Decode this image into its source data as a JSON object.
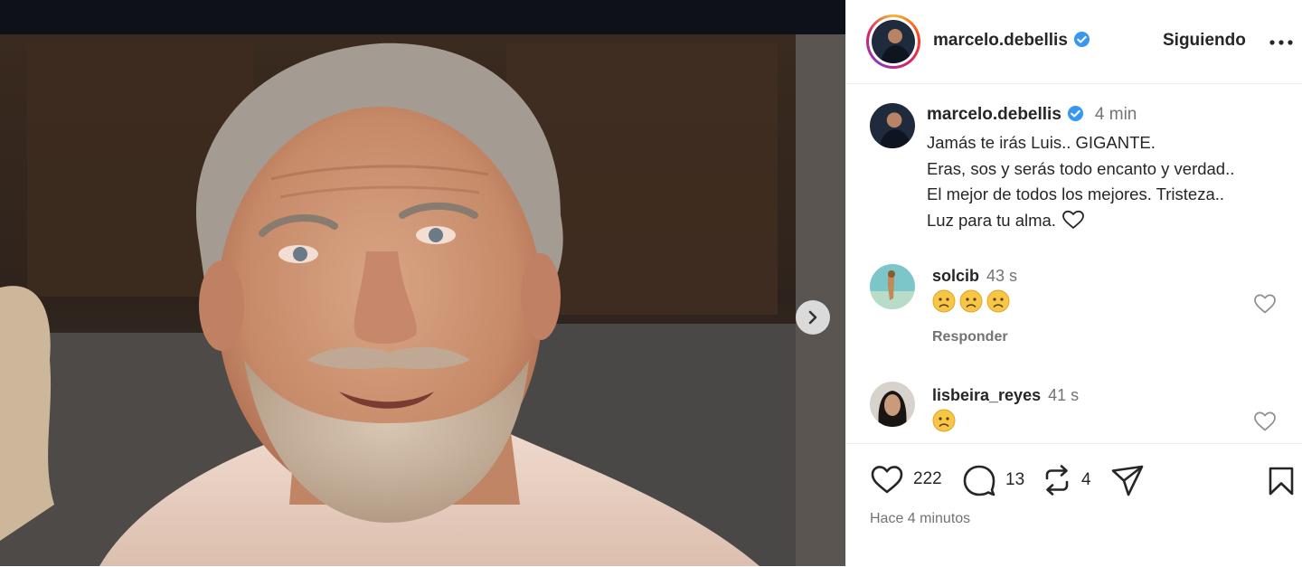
{
  "post": {
    "username": "marcelo.debellis",
    "verified": true,
    "follow_state": "Siguiendo",
    "more_icon": "more-horizontal-icon",
    "next_icon": "chevron-right-icon"
  },
  "caption": {
    "username": "marcelo.debellis",
    "time": "4 min",
    "lines": [
      "Jamás te irás Luis.. GIGANTE.",
      "Eras, sos y serás todo encanto y verdad..",
      "El mejor de todos los mejores. Tristeza..",
      "Luz para tu alma."
    ],
    "trailing_icon": "heart-outline-icon"
  },
  "comments": [
    {
      "username": "solcib",
      "time": "43 s",
      "emoji": "sad-face",
      "emoji_count": 3,
      "reply_label": "Responder"
    },
    {
      "username": "lisbeira_reyes",
      "time": "41 s",
      "emoji": "sad-face",
      "emoji_count": 1
    }
  ],
  "actions": {
    "likes": "222",
    "comments": "13",
    "reposts": "4",
    "icons": [
      "heart-icon",
      "comment-icon",
      "repost-icon",
      "share-icon",
      "save-icon"
    ],
    "timestamp": "Hace 4 minutos"
  },
  "colors": {
    "verified_blue": "#3897f0",
    "text": "#262626",
    "muted": "#737373",
    "emoji_yellow": "#f6c644",
    "media_dark": "#0f1118"
  }
}
